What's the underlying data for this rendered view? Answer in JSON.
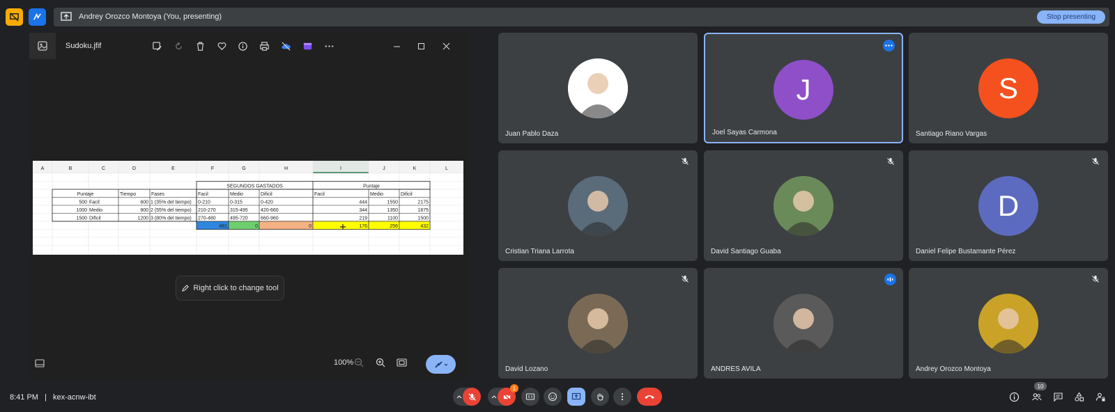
{
  "window": {
    "presenter_label": "Andrey Orozco Montoya (You, presenting)",
    "stop_label": "Stop presenting"
  },
  "viewer": {
    "filename": "Sudoku.jfif",
    "hint": "Right click to change tool",
    "zoom": "100%",
    "toolbar_icons": [
      "edit-image-icon",
      "rotate-icon",
      "delete-icon",
      "favorite-icon",
      "info-icon",
      "print-icon",
      "cloud-off-icon",
      "clipchamp-icon",
      "more-icon"
    ]
  },
  "spreadsheet": {
    "columns": [
      "A",
      "B",
      "C",
      "D",
      "E",
      "F",
      "G",
      "H",
      "I",
      "J",
      "K",
      "L"
    ],
    "group_headers": [
      "SEGUNDOS GASTADOS",
      "Puntaje"
    ],
    "left_headers": [
      "Puntaje",
      "Tiempo",
      "Fases"
    ],
    "right_headers": [
      "Facil",
      "Medio",
      "Dificil",
      "Facil",
      "Medio",
      "Dificil"
    ],
    "rows": [
      [
        "500",
        "Facil",
        "600",
        "1 (35% del tiempo)",
        "0-210",
        "0-315",
        "0-420",
        "444",
        "1550",
        "2175"
      ],
      [
        "1000",
        "Medio",
        "900",
        "2 (55% del tiempo)",
        "210-270",
        "315-495",
        "420-660",
        "344",
        "1350",
        "1875"
      ],
      [
        "1500",
        "Dificil",
        "1200",
        "3 (80% del tiempo)",
        "270-480",
        "495-720",
        "660-960",
        "219",
        "1100",
        "1500"
      ]
    ],
    "totals": [
      "481",
      "0",
      "0",
      "176",
      "256",
      "432"
    ]
  },
  "participants": [
    {
      "name": "Juan Pablo Daza",
      "initial": "",
      "color": "#ffffff",
      "muted": false
    },
    {
      "name": "Joel Sayas Carmona",
      "initial": "J",
      "color": "#8e4fc9",
      "muted": false
    },
    {
      "name": "Santiago Riano Vargas",
      "initial": "S",
      "color": "#f4511e",
      "muted": false
    },
    {
      "name": "Cristian Triana Larrota",
      "initial": "",
      "color": "#5a6b7a",
      "muted": true
    },
    {
      "name": "David Santiago Guaba",
      "initial": "",
      "color": "#6b8a5a",
      "muted": true
    },
    {
      "name": "Daniel Felipe Bustamante Pérez",
      "initial": "D",
      "color": "#5c6bc0",
      "muted": true
    },
    {
      "name": "David Lozano",
      "initial": "",
      "color": "#7a6a55",
      "muted": true
    },
    {
      "name": "ANDRES AVILA",
      "initial": "",
      "color": "#5a5a5a",
      "muted": false
    },
    {
      "name": "Andrey Orozco Montoya",
      "initial": "",
      "color": "#c9a227",
      "muted": true
    }
  ],
  "bottom_bar": {
    "time": "8:41 PM",
    "separator": "|",
    "meeting_code": "kex-acnw-ibt",
    "participant_count": "10",
    "camera_badge": "1"
  },
  "colors": {
    "accent": "#8ab4f8",
    "danger": "#ea4335",
    "bg": "#202124",
    "tile": "#3c4043"
  }
}
